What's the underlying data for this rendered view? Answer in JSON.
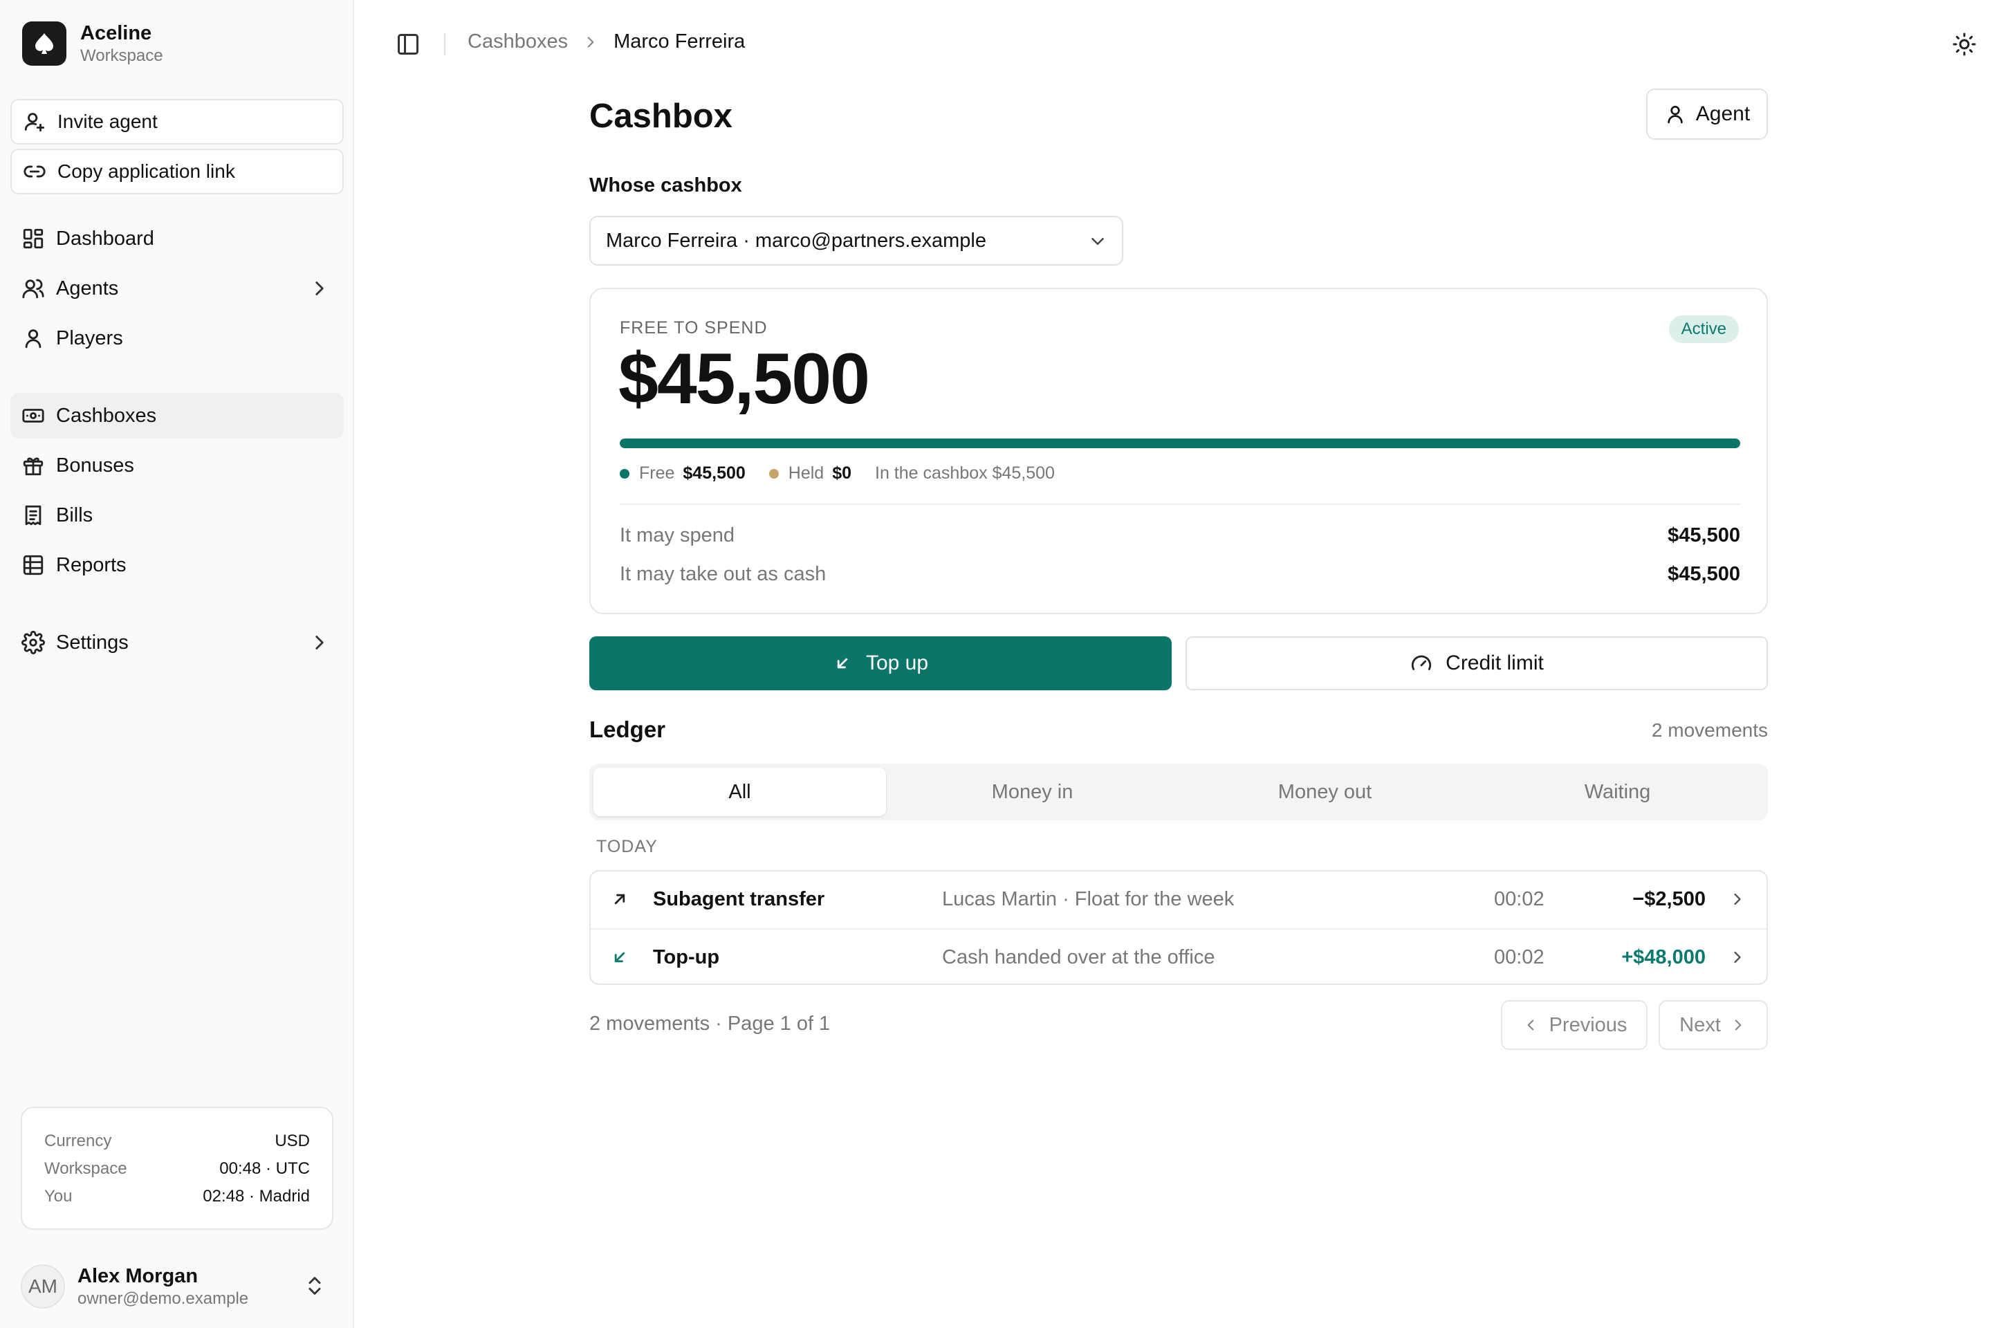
{
  "workspace": {
    "name": "Aceline",
    "subtitle": "Workspace"
  },
  "sidebar": {
    "actions": [
      {
        "label": "Invite agent",
        "icon": "user-plus-icon"
      },
      {
        "label": "Copy application link",
        "icon": "link-icon"
      }
    ],
    "nav": [
      {
        "label": "Dashboard",
        "icon": "dashboard-icon"
      },
      {
        "label": "Agents",
        "icon": "users-icon",
        "has_submenu": true
      },
      {
        "label": "Players",
        "icon": "user-icon"
      },
      {
        "label": "Cashboxes",
        "icon": "cash-icon",
        "active": true
      },
      {
        "label": "Bonuses",
        "icon": "gift-icon"
      },
      {
        "label": "Bills",
        "icon": "receipt-icon"
      },
      {
        "label": "Reports",
        "icon": "table-icon"
      },
      {
        "label": "Settings",
        "icon": "gear-icon",
        "has_submenu": true
      }
    ],
    "info": [
      {
        "label": "Currency",
        "value": "USD"
      },
      {
        "label": "Workspace",
        "value": "00:48 · UTC"
      },
      {
        "label": "You",
        "value": "02:48 · Madrid"
      }
    ],
    "user": {
      "initials": "AM",
      "name": "Alex Morgan",
      "email": "owner@demo.example"
    }
  },
  "topbar": {
    "breadcrumb": {
      "parent": "Cashboxes",
      "current": "Marco Ferreira"
    }
  },
  "page": {
    "title": "Cashbox",
    "agent_button": "Agent",
    "whose_label": "Whose cashbox",
    "whose_value": "Marco Ferreira · marco@partners.example"
  },
  "balance": {
    "label": "FREE TO SPEND",
    "amount": "$45,500",
    "status": "Active",
    "free_fraction": 1.0,
    "legend": {
      "free_label": "Free",
      "free_value": "$45,500",
      "held_label": "Held",
      "held_value": "$0",
      "total": "In the cashbox $45,500"
    },
    "rows": [
      {
        "label": "It may spend",
        "value": "$45,500"
      },
      {
        "label": "It may take out as cash",
        "value": "$45,500"
      }
    ]
  },
  "actions": {
    "topup": "Top up",
    "credit_limit": "Credit limit"
  },
  "ledger": {
    "title": "Ledger",
    "count": "2 movements",
    "tabs": [
      "All",
      "Money in",
      "Money out",
      "Waiting"
    ],
    "active_tab": 0,
    "group_label": "TODAY",
    "rows": [
      {
        "type": "Subagent transfer",
        "direction": "out",
        "icon": "arrow-up-right-icon",
        "description": "Lucas Martin · Float for the week",
        "time": "00:02",
        "amount": "−$2,500"
      },
      {
        "type": "Top-up",
        "direction": "in",
        "icon": "arrow-down-left-icon",
        "description": "Cash handed over at the office",
        "time": "00:02",
        "amount": "+$48,000"
      }
    ],
    "pagination": {
      "summary": "2 movements · Page 1 of 1",
      "previous": "Previous",
      "next": "Next"
    }
  },
  "colors": {
    "accent": "#0b7569",
    "positive": "#0a7a6e",
    "held_dot": "#c9a46a",
    "badge_bg": "#dcefeb"
  }
}
